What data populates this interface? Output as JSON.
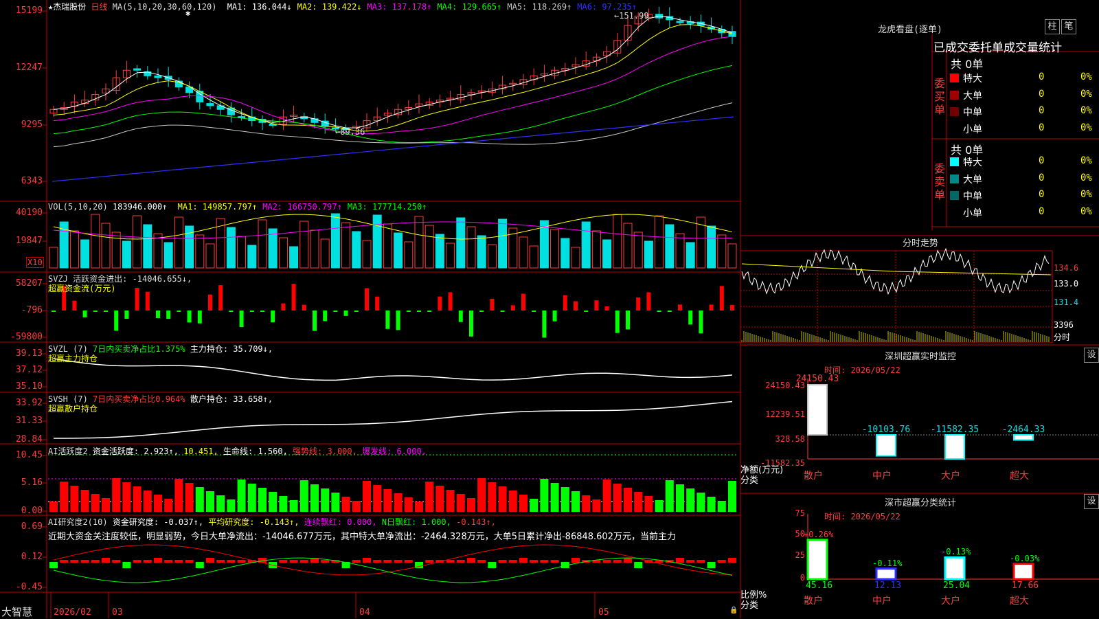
{
  "colors": {
    "up": "#ff3c3c",
    "down": "#00e0e0",
    "ma1": "#ffffff",
    "ma2": "#ffff00",
    "ma3": "#ff00ff",
    "ma4": "#00ff00",
    "ma5": "#c8c8c8",
    "ma6": "#3030ff",
    "grid": "#c00000"
  },
  "main_chart": {
    "star": "★",
    "name": "杰瑞股份",
    "period": "日线",
    "ma_params": "MA(5,10,20,30,60,120)",
    "ma_values": [
      {
        "label": "MA1: 136.044↓",
        "color": "#ffffff"
      },
      {
        "label": "MA2: 139.422↓",
        "color": "#ffff00"
      },
      {
        "label": "MA3: 137.178↑",
        "color": "#ff00ff"
      },
      {
        "label": "MA4: 129.665↑",
        "color": "#00ff00"
      },
      {
        "label": "MA5: 118.269↑",
        "color": "#c8c8c8"
      },
      {
        "label": "MA6: 97.235↑",
        "color": "#3030ff"
      }
    ],
    "y_labels": [
      "15199",
      "12247",
      "9295",
      "6343"
    ],
    "annotations": {
      "high": "151.99",
      "low": "89.36"
    },
    "marker": "✱"
  },
  "vol": {
    "header_name": "VOL(5,10,20)",
    "value": "183946.000↑",
    "ma": [
      {
        "label": "MA1: 149857.797↑",
        "color": "#ffff00"
      },
      {
        "label": "MA2: 166750.797↑",
        "color": "#ff00ff"
      },
      {
        "label": "MA3: 177714.250↑",
        "color": "#00ff00"
      }
    ],
    "y_labels": [
      "40190",
      "19847"
    ],
    "unit": "X10"
  },
  "svzj": {
    "header": "SVZJ  活跃资金进出: -14046.655↓,",
    "sub": "超赢资金流(万元)",
    "y_labels": [
      "58207",
      "-796",
      "-59800"
    ]
  },
  "svzl": {
    "name": "SVZL (7)",
    "p1": "7日内买卖净占比1.375%",
    "p2": "主力持仓: 35.709↓,",
    "sub": "超赢主力持仓",
    "y_labels": [
      "39.13",
      "37.12",
      "35.10"
    ]
  },
  "svsh": {
    "name": "SVSH (7)",
    "p1": "7日内买卖净占比0.964%",
    "p2": "散户持仓: 33.658↑,",
    "sub": "超赢散户持仓",
    "y_labels": [
      "33.92",
      "31.33",
      "28.84"
    ]
  },
  "ai_act": {
    "name": "AI活跃度2",
    "p1": "资金活跃度: 2.923↑,",
    "p2": "10.451,",
    "p3": "生命线: 1.560,",
    "p4": "强势线: 3.000,",
    "p5": "爆发线: 6.000,",
    "y_labels": [
      "10.45",
      "5.16",
      "0.00"
    ]
  },
  "ai_res": {
    "name": "AI研究度2(10)",
    "p1": "资金研究度: -0.037↑,",
    "p2": "平均研究度: -0.143↑,",
    "p3": "连续飘红: 0.000,",
    "p4": "N日飘红: 1.000,",
    "p5": "-0.143↑,",
    "note": "近期大资金关注度较低，明显弱势，今日大单净流出：-14046.677万元，其中特大单净流出：-2464.328万元，大单5日累计净出-86848.602万元，当前主力",
    "y_labels": [
      "0.69",
      "0.12",
      "-0.45"
    ]
  },
  "bottom": {
    "brand": "大智慧",
    "dates": [
      "2026/02",
      "03",
      "04",
      "05"
    ]
  },
  "longhu": {
    "title": "龙虎看盘(逐单)",
    "btn_zhu": "柱",
    "btn_bi": "笔",
    "tabs": "已成交委托单成交量统计",
    "buy_label": "委买单",
    "sell_label": "委卖单",
    "buy_total": "共 0单",
    "sell_total": "共 0单",
    "buy_rows": [
      {
        "label": "特大",
        "count": "0",
        "pct": "0%",
        "color": "#ff0000"
      },
      {
        "label": "大单",
        "count": "0",
        "pct": "0%",
        "color": "#a00000"
      },
      {
        "label": "中单",
        "count": "0",
        "pct": "0%",
        "color": "#700000"
      },
      {
        "label": "小单",
        "count": "0",
        "pct": "0%",
        "color": "#000000"
      }
    ],
    "sell_rows": [
      {
        "label": "特大",
        "count": "0",
        "pct": "0%",
        "color": "#00ffff"
      },
      {
        "label": "大单",
        "count": "0",
        "pct": "0%",
        "color": "#008888"
      },
      {
        "label": "中单",
        "count": "0",
        "pct": "0%",
        "color": "#006666"
      },
      {
        "label": "小单",
        "count": "0",
        "pct": "0%",
        "color": "#000000"
      }
    ]
  },
  "intraday": {
    "title": "分时走势",
    "y_labels": [
      "134.6",
      "133.0",
      "131.4"
    ],
    "vol_label": "3396",
    "vol_name": "分时"
  },
  "sz_monitor": {
    "title": "深圳超赢实时监控",
    "btn": "设",
    "time": "时间: 2026/05/22",
    "y_labels": [
      "24150.43",
      "12239.51",
      "328.58",
      "-11582.35"
    ],
    "values": [
      "24150.43",
      "-10103.76",
      "-11582.35",
      "-2464.33"
    ],
    "ylabel": "净额(万元)",
    "xlabel": "分类",
    "cats": [
      "散户",
      "中户",
      "大户",
      "超大"
    ]
  },
  "sz_class": {
    "title": "深市超赢分类统计",
    "btn": "设",
    "time": "时间: 2026/05/22",
    "y_labels": [
      "75",
      "50",
      "25",
      "0"
    ],
    "changes": [
      "+0.26%",
      "-0.11%",
      "-0.13%",
      "-0.03%"
    ],
    "values": [
      "45.16",
      "12.13",
      "25.04",
      "17.66"
    ],
    "ylabel": "比例%",
    "xlabel": "分类",
    "cats": [
      "散户",
      "中户",
      "大户",
      "超大"
    ]
  }
}
